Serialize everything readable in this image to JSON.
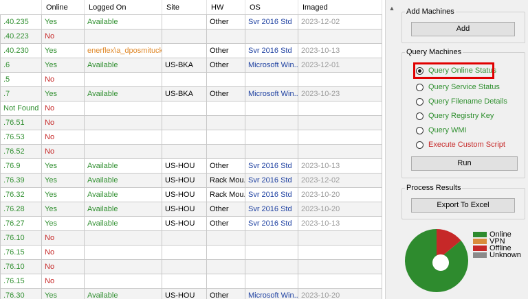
{
  "grid": {
    "columns": [
      "",
      "Online",
      "Logged On",
      "Site",
      "HW",
      "OS",
      "Imaged"
    ],
    "rows": [
      [
        ".40.235",
        "Yes",
        "Available",
        "",
        "Other",
        "Svr 2016 Std",
        "2023-12-02"
      ],
      [
        ".40.223",
        "No",
        "",
        "",
        "",
        "",
        ""
      ],
      [
        ".40.230",
        "Yes",
        "enerflex\\a_dposmituck",
        "",
        "Other",
        "Svr 2016 Std",
        "2023-10-13"
      ],
      [
        ".6",
        "Yes",
        "Available",
        "US-BKA",
        "Other",
        "Microsoft Win...",
        "2023-12-01"
      ],
      [
        ".5",
        "No",
        "",
        "",
        "",
        "",
        ""
      ],
      [
        ".7",
        "Yes",
        "Available",
        "US-BKA",
        "Other",
        "Microsoft Win...",
        "2023-10-23"
      ],
      [
        "Not Found",
        "No",
        "",
        "",
        "",
        "",
        ""
      ],
      [
        ".76.51",
        "No",
        "",
        "",
        "",
        "",
        ""
      ],
      [
        ".76.53",
        "No",
        "",
        "",
        "",
        "",
        ""
      ],
      [
        ".76.52",
        "No",
        "",
        "",
        "",
        "",
        ""
      ],
      [
        ".76.9",
        "Yes",
        "Available",
        "US-HOU",
        "Other",
        "Svr 2016 Std",
        "2023-10-13"
      ],
      [
        ".76.39",
        "Yes",
        "Available",
        "US-HOU",
        "Rack Mou...",
        "Svr 2016 Std",
        "2023-12-02"
      ],
      [
        ".76.32",
        "Yes",
        "Available",
        "US-HOU",
        "Rack Mou...",
        "Svr 2016 Std",
        "2023-10-20"
      ],
      [
        ".76.28",
        "Yes",
        "Available",
        "US-HOU",
        "Other",
        "Svr 2016 Std",
        "2023-10-20"
      ],
      [
        ".76.27",
        "Yes",
        "Available",
        "US-HOU",
        "Other",
        "Svr 2016 Std",
        "2023-10-13"
      ],
      [
        ".76.10",
        "No",
        "",
        "",
        "",
        "",
        ""
      ],
      [
        ".76.15",
        "No",
        "",
        "",
        "",
        "",
        ""
      ],
      [
        ".76.10",
        "No",
        "",
        "",
        "",
        "",
        ""
      ],
      [
        ".76.15",
        "No",
        "",
        "",
        "",
        "",
        ""
      ],
      [
        ".76.30",
        "Yes",
        "Available",
        "US-HOU",
        "Other",
        "Microsoft Win...",
        "2023-10-20"
      ]
    ]
  },
  "add_machines": {
    "title": "Add Machines",
    "add_label": "Add"
  },
  "query_machines": {
    "title": "Query Machines",
    "options": [
      "Query Online Status",
      "Query Service Status",
      "Query Filename Details",
      "Query Registry Key",
      "Query WMI",
      "Execute Custom Script"
    ],
    "selected_index": 0,
    "run_label": "Run"
  },
  "process_results": {
    "title": "Process Results",
    "export_label": "Export To Excel"
  },
  "chart_data": {
    "type": "pie",
    "categories": [
      "Online",
      "VPN",
      "Offline",
      "Unknown"
    ],
    "values": [
      86,
      0,
      14,
      0
    ],
    "colors": [
      "#2e8b2e",
      "#d98c3c",
      "#c62828",
      "#8a8a8a"
    ],
    "legend_position": "right"
  },
  "icons": {
    "scroll_up": "chevron-up-icon"
  }
}
